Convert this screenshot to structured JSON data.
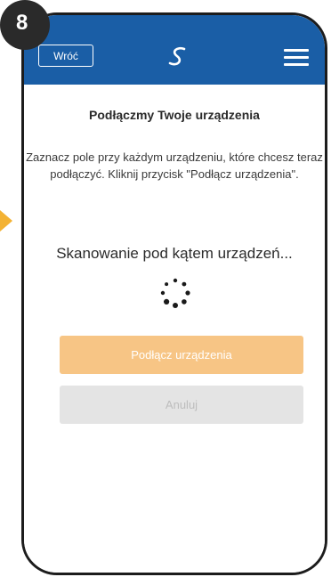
{
  "step": {
    "number": "8"
  },
  "header": {
    "back_label": "Wróć",
    "logo_icon": "swirl-logo-icon",
    "menu_icon": "hamburger-menu-icon",
    "background_color": "#1a5ea6"
  },
  "main": {
    "title": "Podłączmy Twoje urządzenia",
    "instructions": "Zaznacz pole przy każdym urządzeniu, które chcesz teraz podłączyć. Kliknij przycisk \"Podłącz urządzenia\".",
    "scanning_text": "Skanowanie pod kątem urządzeń...",
    "connect_button": "Podłącz urządzenia",
    "cancel_button": "Anuluj"
  },
  "colors": {
    "accent_orange": "#f7c585",
    "cancel_gray": "#e4e4e4",
    "arrow_yellow": "#f3b233"
  }
}
